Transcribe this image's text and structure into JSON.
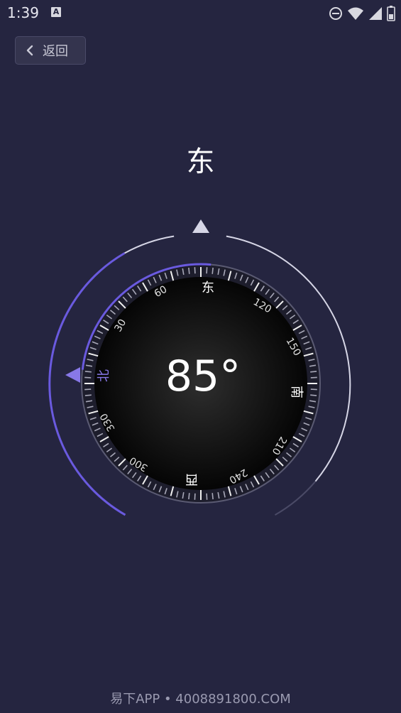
{
  "status_bar": {
    "time": "1:39",
    "notification_badge": "A",
    "icons": [
      "do-not-disturb-icon",
      "wifi-icon",
      "signal-icon",
      "battery-icon"
    ]
  },
  "header": {
    "back_label": "返回"
  },
  "direction": {
    "cardinal": "东",
    "heading_text": "85°",
    "heading_degrees": 85
  },
  "dial": {
    "degree_labels": [
      "30",
      "60",
      "120",
      "150",
      "210",
      "240",
      "300",
      "330"
    ],
    "cardinal_labels": {
      "north": "北",
      "east": "东",
      "south": "南",
      "west": "西"
    }
  },
  "colors": {
    "background": "#252540",
    "accent": "#6a5adf",
    "indicator": "#d6d6e6",
    "north_marker": "#8878e8"
  },
  "footer": {
    "text": "易下APP • 4008891800.COM"
  }
}
